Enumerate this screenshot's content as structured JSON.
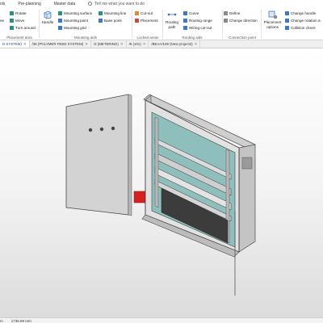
{
  "menu": {
    "items": [
      "ols",
      "Pre-planning",
      "Master data"
    ],
    "tell_me": "Tell me what you want to do"
  },
  "ribbon": {
    "group1": {
      "label": "Placement area",
      "cmd_rotate": "Rotate",
      "cmd_move": "Move",
      "cmd_turn": "Turn around",
      "cmd_left": "ee"
    },
    "group2": {
      "label": "Mounting aids",
      "cmd_handle": "Handle",
      "cmd_surface": "Mounting surface",
      "cmd_point": "Mounting point",
      "cmd_grid": "Mounting grid",
      "cmd_line": "Mounting line",
      "cmd_base": "Base point"
    },
    "group3": {
      "label": "Locked areas",
      "cmd_cutout": "Cut-out",
      "cmd_placement": "Placement"
    },
    "group4": {
      "label": "Routing aids",
      "cmd_path": "Routing path",
      "cmd_curve": "Curve",
      "cmd_range": "Routing range",
      "cmd_wiring": "Wiring cut-out"
    },
    "group5": {
      "label": "Connection point",
      "cmd_define": "Define",
      "cmd_direction": "Change direction"
    },
    "group6": {
      "cmd_options": "Placement options",
      "cmd_handle": "Change handle",
      "cmd_rotation": "Change rotation a",
      "cmd_collision": "Collision check"
    }
  },
  "tabs": [
    "D SYSTEM)",
    "/36 (POLYMER FEED SYSTEM)",
    "/2 (METERING)",
    "/9 (101)",
    "/BEAA/109 (New project2)"
  ],
  "status": {
    "left": "m",
    "measure": "1736.69 mm"
  }
}
